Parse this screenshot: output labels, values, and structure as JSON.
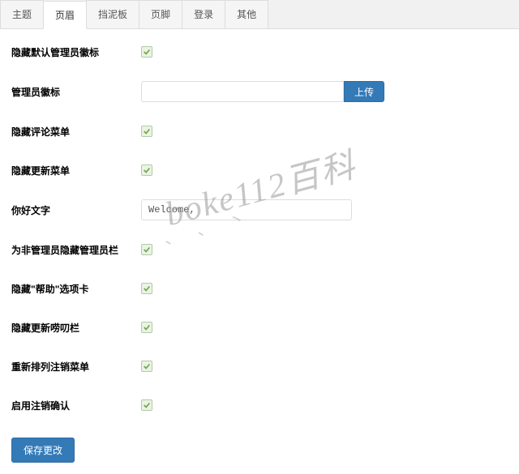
{
  "tabs": [
    {
      "label": "主题",
      "active": false
    },
    {
      "label": "页眉",
      "active": true
    },
    {
      "label": "挡泥板",
      "active": false
    },
    {
      "label": "页脚",
      "active": false
    },
    {
      "label": "登录",
      "active": false
    },
    {
      "label": "其他",
      "active": false
    }
  ],
  "rows": {
    "hide_default_admin_badge": {
      "label": "隐藏默认管理员徽标",
      "type": "checkbox",
      "checked": true
    },
    "admin_badge": {
      "label": "管理员徽标",
      "type": "upload",
      "value": "",
      "button": "上传"
    },
    "hide_comment_menu": {
      "label": "隐藏评论菜单",
      "type": "checkbox",
      "checked": true
    },
    "hide_update_menu": {
      "label": "隐藏更新菜单",
      "type": "checkbox",
      "checked": true
    },
    "hello_text": {
      "label": "你好文字",
      "type": "text",
      "value": "Welcome,"
    },
    "hide_admin_bar_nonadmin": {
      "label": "为非管理员隐藏管理员栏",
      "type": "checkbox",
      "checked": true
    },
    "hide_help_tab": {
      "label": "隐藏\"帮助\"选项卡",
      "type": "checkbox",
      "checked": true
    },
    "hide_update_nag": {
      "label": "隐藏更新唠叨栏",
      "type": "checkbox",
      "checked": true
    },
    "rearrange_logout": {
      "label": "重新排列注销菜单",
      "type": "checkbox",
      "checked": true
    },
    "enable_logout_confirm": {
      "label": "启用注销确认",
      "type": "checkbox",
      "checked": true
    }
  },
  "save_label": "保存更改",
  "watermark": "boke112百科"
}
